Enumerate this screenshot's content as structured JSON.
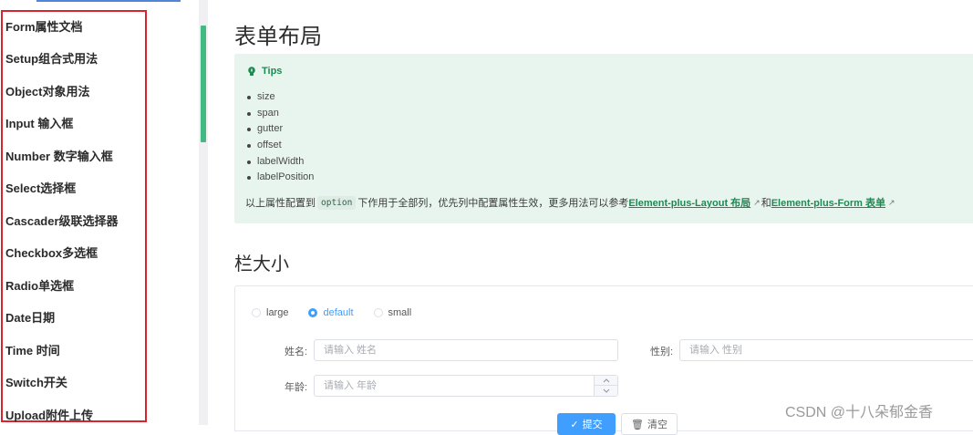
{
  "sidebar": {
    "items": [
      {
        "label": "Form属性文档"
      },
      {
        "label": "Setup组合式用法"
      },
      {
        "label": "Object对象用法"
      },
      {
        "label": "Input 输入框"
      },
      {
        "label": "Number 数字输入框"
      },
      {
        "label": "Select选择框"
      },
      {
        "label": "Cascader级联选择器"
      },
      {
        "label": "Checkbox多选框"
      },
      {
        "label": "Radio单选框"
      },
      {
        "label": "Date日期"
      },
      {
        "label": "Time 时间"
      },
      {
        "label": "Switch开关"
      },
      {
        "label": "Upload附件上传"
      }
    ]
  },
  "main": {
    "title": "表单布局",
    "tips": {
      "heading": "Tips",
      "items": [
        "size",
        "span",
        "gutter",
        "offset",
        "labelWidth",
        "labelPosition"
      ],
      "desc_prefix": "以上属性配置到",
      "desc_code": "option",
      "desc_middle": "下作用于全部列，优先列中配置属性生效，更多用法可以参考",
      "link1": "Element-plus-Layout 布局",
      "desc_and": "和",
      "link2": "Element-plus-Form 表单"
    },
    "section_title": "栏大小",
    "demo": {
      "radios": [
        {
          "label": "large",
          "checked": false
        },
        {
          "label": "default",
          "checked": true
        },
        {
          "label": "small",
          "checked": false
        }
      ],
      "fields": {
        "name": {
          "label": "姓名:",
          "placeholder": "请输入 姓名"
        },
        "gender": {
          "label": "性别:",
          "placeholder": "请输入 性别"
        },
        "age": {
          "label": "年龄:",
          "placeholder": "请输入 年龄"
        }
      },
      "submit_label": "提交",
      "clear_label": "清空"
    }
  },
  "watermark": "CSDN @十八朵郁金香",
  "colors": {
    "accent": "#42b883",
    "primary": "#409eff",
    "tips_bg": "#e8f5ee",
    "highlight_box": "#d9242f"
  }
}
